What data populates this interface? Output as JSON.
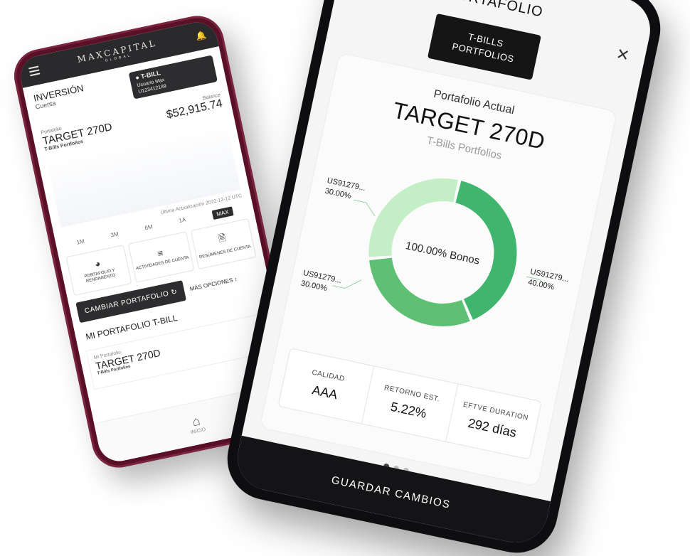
{
  "left_phone": {
    "brand": {
      "name": "MAXCAPITAL",
      "sub": "GLOBAL"
    },
    "account": {
      "title": "INVERSIÓN",
      "subtitle": "Cuenta"
    },
    "card": {
      "type": "T-BILL",
      "user": "Usuario Max",
      "number": "U123412189"
    },
    "portfolio": {
      "label": "Portafolio",
      "name": "TARGET 270D",
      "sub": "T-Bills Portfolios"
    },
    "balance": {
      "label": "Balance",
      "value": "$52,915.74"
    },
    "updated": "Última Actualización 2022-12-12 UTC",
    "ranges": [
      "1M",
      "3M",
      "6M",
      "1A",
      "MAX"
    ],
    "active_range": "MAX",
    "actions": [
      {
        "label": "PORTAFOLIO Y RENDIMIENTO",
        "icon": "pie-chart-icon"
      },
      {
        "label": "ACTIVIDADES DE CUENTA",
        "icon": "list-icon"
      },
      {
        "label": "RESÚMENES DE CUENTA",
        "icon": "document-icon"
      }
    ],
    "change_button": "CAMBIAR PORTAFOLIO",
    "more_options": "MÁS OPCIONES",
    "my_portfolio_title": "MI PORTAFOLIO T-BILL",
    "my_portfolio": {
      "label": "Mi Portafolio",
      "name": "TARGET 270D",
      "sub": "T-Bills Portfolios"
    },
    "nav_home": "INICIO"
  },
  "right_phone": {
    "header_title": "PORTAFOLIO",
    "tag": {
      "line1": "T-BILLS",
      "line2": "PORTFOLIOS"
    },
    "current_label": "Portafolio Actual",
    "target": "TARGET 270D",
    "target_sub": "T-Bills Portfolios",
    "donut_center": "100.00% Bonos",
    "donut_segments": [
      {
        "name": "US91279...",
        "value": "40.00%",
        "fraction": 0.4,
        "color": "#3fb56d"
      },
      {
        "name": "US91279...",
        "value": "30.00%",
        "fraction": 0.3,
        "color": "#5fbf74"
      },
      {
        "name": "US91279...",
        "value": "30.00%",
        "fraction": 0.3,
        "color": "#c4efc6"
      }
    ],
    "metrics": [
      {
        "key": "CALIDAD",
        "value": "AAA"
      },
      {
        "key": "RETORNO EST.",
        "value": "5.22%"
      },
      {
        "key": "EFTVE DURATION",
        "value": "292 días"
      }
    ],
    "save_button": "GUARDAR CAMBIOS"
  }
}
